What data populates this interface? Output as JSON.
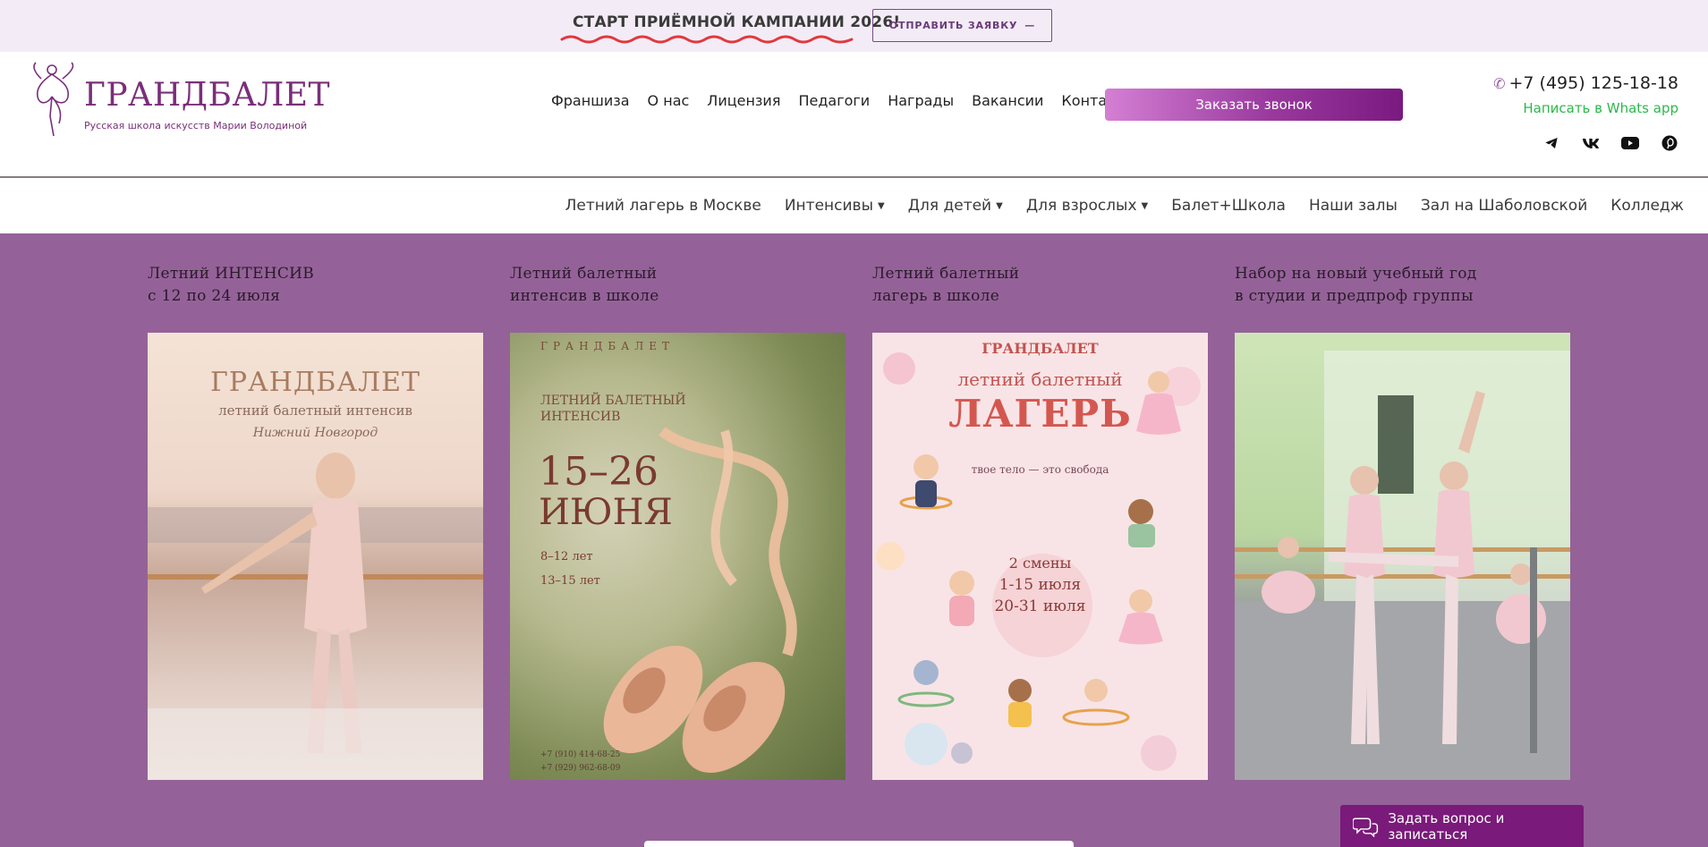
{
  "topbar": {
    "headline": "СТАРТ ПРИЁМНОЙ КАМПАНИИ 2026!",
    "apply_label": "ОТПРАВИТЬ ЗАЯВКУ",
    "apply_arrow": "—"
  },
  "logo": {
    "brand": "ГРАНДБАЛЕТ",
    "tagline": "Русская школа искусств Марии Володиной"
  },
  "main_nav": [
    "Франшиза",
    "О нас",
    "Лицензия",
    "Педагоги",
    "Награды",
    "Вакансии",
    "Контакты"
  ],
  "callback_label": "Заказать звонок",
  "contacts": {
    "phone": "+7 (495) 125-18-18",
    "whatsapp": "Написать в Whats app",
    "socials": [
      "telegram-icon",
      "vk-icon",
      "youtube-icon",
      "pinterest-icon"
    ]
  },
  "sub_nav": [
    {
      "label": "Летний лагерь в Москве",
      "dropdown": false
    },
    {
      "label": "Интенсивы",
      "dropdown": true
    },
    {
      "label": "Для детей",
      "dropdown": true
    },
    {
      "label": "Для взрослых",
      "dropdown": true
    },
    {
      "label": "Балет+Школа",
      "dropdown": false
    },
    {
      "label": "Наши залы",
      "dropdown": false
    },
    {
      "label": "Зал на Шаболовской",
      "dropdown": false
    },
    {
      "label": "Колледж",
      "dropdown": false
    }
  ],
  "cards": [
    {
      "title_line1": "Летний ИНТЕНСИВ",
      "title_line2": "с 12 по 24 июля",
      "poster": {
        "brand": "ГРАНДБАЛЕТ",
        "subtitle": "летний балетный интенсив",
        "city": "Нижний Новгород"
      }
    },
    {
      "title_line1": "Летний балетный",
      "title_line2": "интенсив в школе",
      "poster": {
        "brand": "ГРАНДБАЛЕТ",
        "subtitle_line1": "ЛЕТНИЙ БАЛЕТНЫЙ",
        "subtitle_line2": "ИНТЕНСИВ",
        "dates": "15–26",
        "month": "ИЮНЯ",
        "age1": "8–12 лет",
        "age2": "13–15 лет",
        "phone1": "+7 (910) 414-68-25",
        "phone2": "+7 (929) 962-68-09"
      }
    },
    {
      "title_line1": "Летний балетный",
      "title_line2": "лагерь в школе",
      "poster": {
        "brand": "ГРАНДБАЛЕТ",
        "subtitle": "летний балетный",
        "big": "ЛАГЕРЬ",
        "slogan": "твое тело — это свобода",
        "shifts": "2 смены",
        "shift1": "1-15 июля",
        "shift2": "20-31 июля"
      }
    },
    {
      "title_line1": "Набор на новый учебный год",
      "title_line2": "в студии и предпроф группы",
      "poster": {}
    }
  ],
  "chat_label": "Задать вопрос и записаться",
  "colors": {
    "accent": "#7a2e7a",
    "content_bg": "#946298",
    "topbar_bg": "#f3ecf6",
    "whatsapp": "#2bb84a"
  }
}
